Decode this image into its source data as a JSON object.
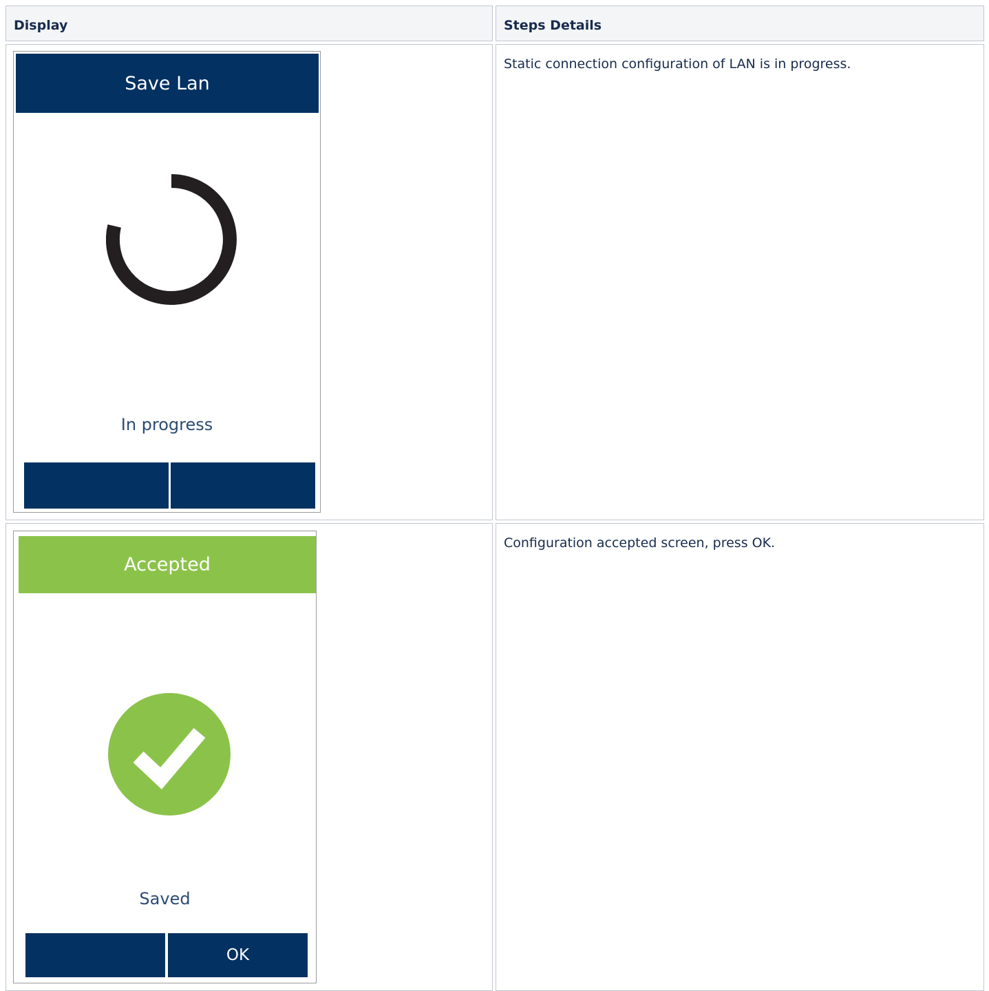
{
  "table": {
    "headers": {
      "display": "Display",
      "steps_details": "Steps Details"
    },
    "rows": [
      {
        "screen": {
          "title": "Save Lan",
          "title_color": "#033161",
          "icon": "spinner-icon",
          "status": "In progress",
          "status_color": "#2b4b73",
          "left_button": "",
          "right_button": ""
        },
        "details": "Static connection configuration of LAN is in progress."
      },
      {
        "screen": {
          "title": "Accepted",
          "title_color": "#8bc34a",
          "icon": "check-circle-icon",
          "status": "Saved",
          "status_color": "#2b4b73",
          "left_button": "",
          "right_button": "OK"
        },
        "details": "Configuration accepted screen, press OK."
      }
    ]
  },
  "colors": {
    "button": "#033161",
    "success": "#8bc34a",
    "spinner": "#231f20",
    "header_bg": "#f4f5f7",
    "border": "#c1c7d0"
  }
}
